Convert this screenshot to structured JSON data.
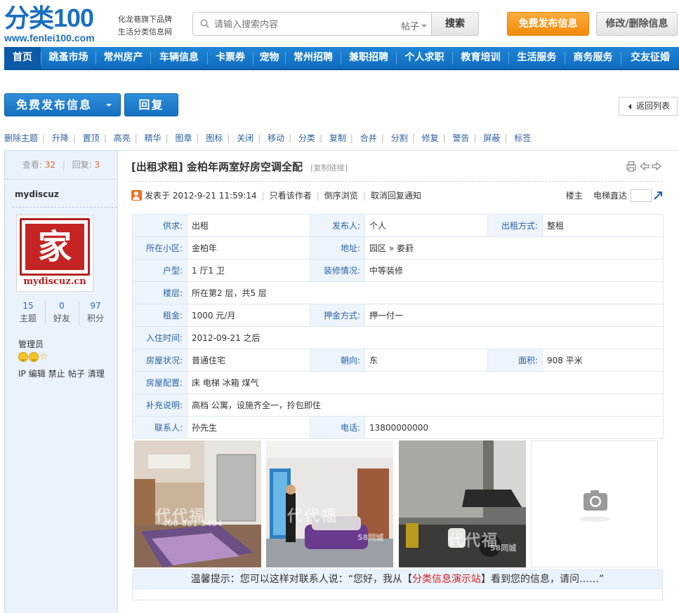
{
  "header": {
    "logo_main": "分类100",
    "logo_url": "www.fenlei100.com",
    "slogan_line1": "化龙巷旗下品牌",
    "slogan_line2": "生活分类信息网",
    "search_placeholder": "请输入搜索内容",
    "search_type": "帖子",
    "search_button": "搜索",
    "publish_button": "免费发布信息",
    "edit_button": "修改/删除信息"
  },
  "nav": [
    "首页",
    "跳蚤市场",
    "常州房产",
    "车辆信息",
    "卡票券",
    "宠物",
    "常州招聘",
    "兼职招聘",
    "个人求职",
    "教育培训",
    "生活服务",
    "商务服务",
    "交友征婚"
  ],
  "actions": {
    "publish_label": "免费发布信息",
    "reply_label": "回复",
    "back_label": "返回列表"
  },
  "mod_tools": [
    "删除主题",
    "升降",
    "置顶",
    "高亮",
    "精华",
    "图章",
    "图标",
    "关闭",
    "移动",
    "分类",
    "复制",
    "合并",
    "分割",
    "修复",
    "警告",
    "屏蔽",
    "标签"
  ],
  "sidebar": {
    "views_label": "查看:",
    "views": "32",
    "replies_label": "回复:",
    "replies": "3",
    "username": "mydiscuz",
    "avatar_char": "家",
    "avatar_text": "mydiscuz.cn",
    "stats": [
      {
        "value": "15",
        "label": "主题"
      },
      {
        "value": "0",
        "label": "好友"
      },
      {
        "value": "97",
        "label": "积分"
      }
    ],
    "role": "管理员",
    "admin_links": [
      "IP",
      "编辑",
      "禁止",
      "帖子",
      "清理"
    ]
  },
  "post": {
    "category": "[出租求租]",
    "title": "金柏年两室好房空调全配",
    "copy_link": "[复制链接]",
    "posted_at": "发表于 2012-9-21 11:59:14",
    "only_author": "只看该作者",
    "reverse_view": "倒序浏览",
    "cancel_notify": "取消回复通知",
    "floor_label": "楼主",
    "jump_label": "电梯直达",
    "tip_prefix": "温馨提示：您可以这样对联系人说：“您好，我从【",
    "tip_site": "分类信息演示站",
    "tip_suffix": "】看到您的信息，请问……”"
  },
  "info": {
    "supply_label": "供求:",
    "supply": "出租",
    "publisher_label": "发布人:",
    "publisher": "个人",
    "rent_mode_label": "出租方式:",
    "rent_mode": "整租",
    "community_label": "所在小区:",
    "community": "金柏年",
    "address_label": "地址:",
    "address": "园区 » 娄葑",
    "layout_label": "户型:",
    "layout": "1 厅1 卫",
    "decor_label": "装修情况:",
    "decor": "中等装修",
    "floor_label": "楼层:",
    "floor": "所在第2 层，共5 层",
    "rent_label": "租金:",
    "rent": "1000 元/月",
    "deposit_label": "押金方式:",
    "deposit": "押一付一",
    "movein_label": "入住时间:",
    "movein": "2012-09-21 之后",
    "status_label": "房屋状况:",
    "status": "普通住宅",
    "facing_label": "朝向:",
    "facing": "东",
    "area_label": "面积:",
    "area": "908 平米",
    "facilities_label": "房屋配置:",
    "facilities": "床 电梯 冰箱 煤气",
    "extra_label": "补充说明:",
    "extra": "高档 公寓，设施齐全一，拎包即住",
    "contact_label": "联系人:",
    "contact": "孙先生",
    "phone_label": "电话:",
    "phone": "13800000000"
  },
  "photos": {
    "watermark": "代代福",
    "watermark_phone": "400-881-3404",
    "watermark_58": "58同城"
  },
  "colors": {
    "brand_blue": "#1b6fc2",
    "nav_blue": "#1670c0",
    "publish_orange": "#f18a0a",
    "highlight_red": "#d01f1f"
  }
}
